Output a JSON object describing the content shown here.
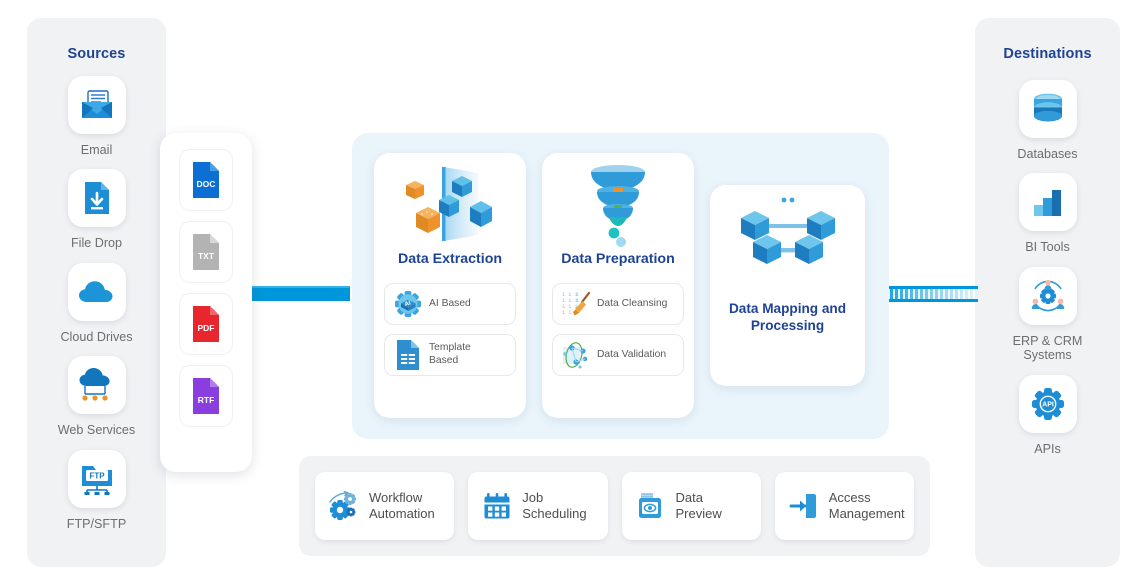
{
  "sources": {
    "title": "Sources",
    "items": [
      {
        "label": "Email",
        "icon": "email-icon"
      },
      {
        "label": "File Drop",
        "icon": "file-drop-icon"
      },
      {
        "label": "Cloud Drives",
        "icon": "cloud-icon"
      },
      {
        "label": "Web Services",
        "icon": "web-services-icon"
      },
      {
        "label": "FTP/SFTP",
        "icon": "ftp-icon"
      }
    ]
  },
  "file_types": {
    "items": [
      {
        "label": "DOC",
        "color": "#0b6fd4",
        "fold": "#4a9fe3",
        "icon": "doc-file-icon"
      },
      {
        "label": "TXT",
        "color": "#b3b3b3",
        "fold": "#d4d4d4",
        "icon": "txt-file-icon"
      },
      {
        "label": "PDF",
        "color": "#e8262d",
        "fold": "#f0676b",
        "icon": "pdf-file-icon"
      },
      {
        "label": "RTF",
        "color": "#8b3ee0",
        "fold": "#b27bee",
        "icon": "rtf-file-icon"
      }
    ]
  },
  "process": {
    "cards": [
      {
        "title": "Data Extraction",
        "icon": "cubes-through-filter-icon",
        "subcards": [
          {
            "label": "AI Based",
            "icon": "ai-chip-gear-icon"
          },
          {
            "label": "Template\nBased",
            "icon": "template-document-icon"
          }
        ]
      },
      {
        "title": "Data Preparation",
        "icon": "funnel-icon",
        "subcards": [
          {
            "label": "Data Cleansing",
            "icon": "broom-binary-icon"
          },
          {
            "label": "Data Validation",
            "icon": "molecule-validation-icon"
          }
        ]
      },
      {
        "title": "Data Mapping and Processing",
        "icon": "connected-cubes-icon",
        "subcards": []
      }
    ]
  },
  "features": {
    "items": [
      {
        "label": "Workflow\nAutomation",
        "icon": "gears-automation-icon"
      },
      {
        "label": "Job\nScheduling",
        "icon": "calendar-icon"
      },
      {
        "label": "Data\nPreview",
        "icon": "document-eye-icon"
      },
      {
        "label": "Access\nManagement",
        "icon": "login-arrow-icon"
      }
    ]
  },
  "destinations": {
    "title": "Destinations",
    "items": [
      {
        "label": "Databases",
        "icon": "database-icon"
      },
      {
        "label": "BI Tools",
        "icon": "bar-chart-icon"
      },
      {
        "label": "ERP & CRM\nSystems",
        "icon": "erp-crm-icon"
      },
      {
        "label": "APIs",
        "icon": "api-gear-icon"
      }
    ]
  },
  "colors": {
    "brand_blue": "#0096db",
    "navy": "#1f4394",
    "panel_gray": "#f1f2f4",
    "process_panel_blue": "#e9f4fb",
    "label_gray": "#6e6e6e",
    "accent_orange": "#f0922b"
  }
}
